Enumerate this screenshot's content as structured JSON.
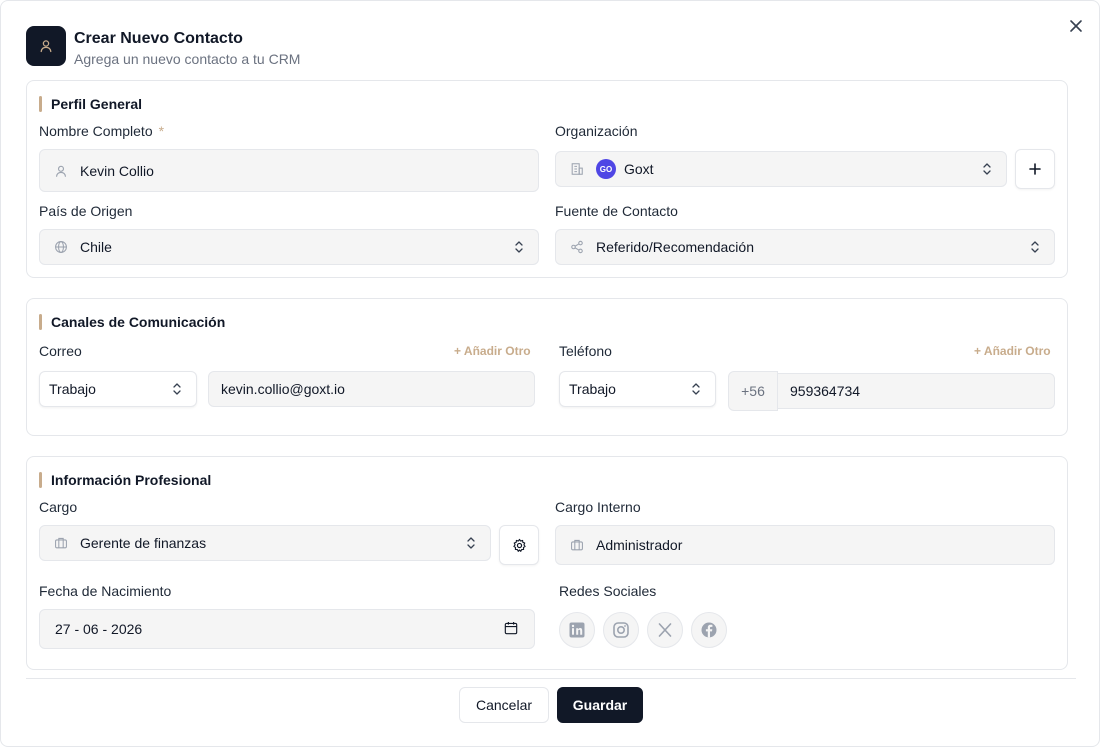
{
  "header": {
    "title": "Crear Nuevo Contacto",
    "subtitle": "Agrega un nuevo contacto a tu CRM"
  },
  "perfil": {
    "title": "Perfil General",
    "nombre_label": "Nombre Completo",
    "required_mark": "*",
    "nombre_value": "Kevin Collio",
    "organizacion_label": "Organización",
    "organizacion_badge": "GO",
    "organizacion_value": "Goxt",
    "pais_label": "País de Origen",
    "pais_value": "Chile",
    "fuente_label": "Fuente de Contacto",
    "fuente_value": "Referido/Recomendación"
  },
  "canales": {
    "title": "Canales de Comunicación",
    "correo_label": "Correo",
    "correo_add": "+ Añadir Otro",
    "correo_type": "Trabajo",
    "correo_value": "kevin.collio@goxt.io",
    "telefono_label": "Teléfono",
    "telefono_add": "+ Añadir Otro",
    "telefono_type": "Trabajo",
    "telefono_prefix": "+56",
    "telefono_value": "959364734"
  },
  "profesional": {
    "title": "Información Profesional",
    "cargo_label": "Cargo",
    "cargo_value": "Gerente de finanzas",
    "cargo_interno_label": "Cargo Interno",
    "cargo_interno_value": "Administrador",
    "fecha_label": "Fecha de Nacimiento",
    "fecha_value": "27 - 06 - 2026",
    "redes_label": "Redes Sociales"
  },
  "footer": {
    "cancel_label": "Cancelar",
    "save_label": "Guardar"
  },
  "colors": {
    "accent": "#c8ac8c",
    "primary": "#111827",
    "badge": "#4f46e5"
  },
  "icons": [
    "close-icon",
    "user-icon",
    "building-icon",
    "plus-icon",
    "globe-icon",
    "share-icon",
    "chevron-updown-icon",
    "briefcase-icon",
    "gear-icon",
    "calendar-icon",
    "linkedin-icon",
    "instagram-icon",
    "x-icon",
    "facebook-icon"
  ]
}
